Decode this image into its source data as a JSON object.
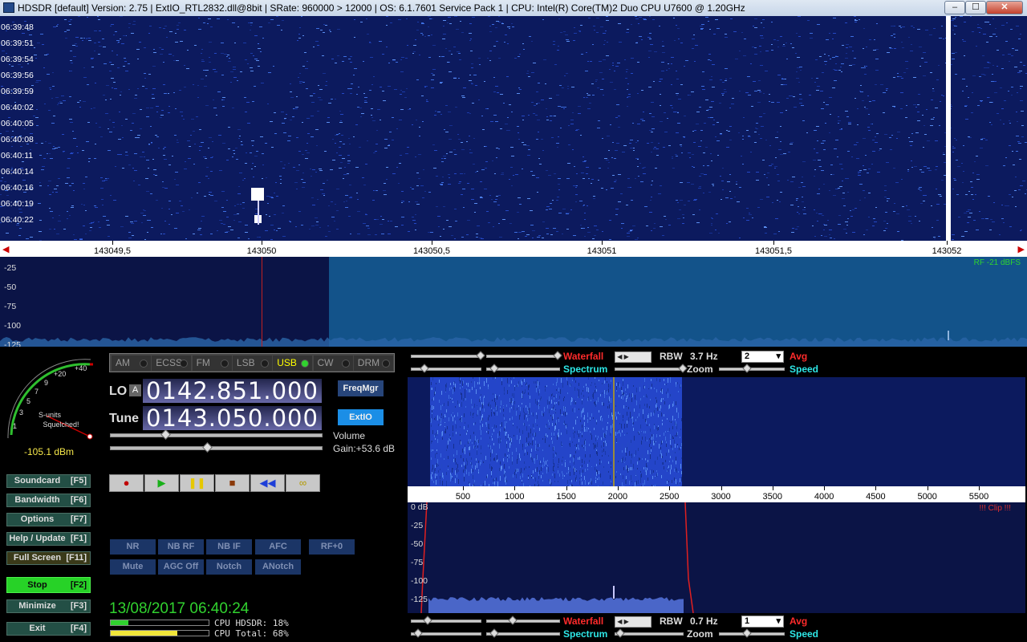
{
  "window": {
    "title": "HDSDR  [default]  Version: 2.75   |  ExtIO_RTL2832.dll@8bit  |  SRate: 960000 > 12000  |  OS: 6.1.7601  Service Pack 1  |  CPU: Intel(R) Core(TM)2 Duo CPU     U7600  @ 1.20GHz",
    "app_icon": "hdsdr-app-icon",
    "controls": {
      "minimize": "–",
      "maximize": "☐",
      "close": "✕"
    }
  },
  "waterfall": {
    "timestamps": [
      "06:39:48",
      "06:39:51",
      "06:39:54",
      "06:39:56",
      "06:39:59",
      "06:40:02",
      "06:40:05",
      "06:40:08",
      "06:40:11",
      "06:40:14",
      "06:40:16",
      "06:40:19",
      "06:40:22"
    ],
    "background_color": "#0c1a5e"
  },
  "frequency_axis": {
    "labels": [
      "143049,5",
      "143050",
      "143050,5",
      "143051",
      "143051,5",
      "143052"
    ]
  },
  "spectrum": {
    "db_labels": [
      "-25",
      "-50",
      "-75",
      "-100",
      "-125"
    ],
    "rf_level": "RF -21 dBFS"
  },
  "smeter": {
    "scale_labels": [
      "1",
      "3",
      "5",
      "7",
      "9",
      "+20",
      "+40"
    ],
    "caption_line1": "S-units",
    "caption_line2": "Squelched!",
    "dbm": "-105.1 dBm"
  },
  "modes": [
    {
      "label": "AM",
      "active": false
    },
    {
      "label": "ECSS",
      "active": false
    },
    {
      "label": "FM",
      "active": false
    },
    {
      "label": "LSB",
      "active": false
    },
    {
      "label": "USB",
      "active": true
    },
    {
      "label": "CW",
      "active": false
    },
    {
      "label": "DRM",
      "active": false
    }
  ],
  "lo": {
    "label": "LO",
    "badge": "A",
    "value": "0142.851.000"
  },
  "tune": {
    "label": "Tune",
    "value": "0143.050.000"
  },
  "buttons": {
    "freqmgr": "FreqMgr",
    "extio": "ExtIO"
  },
  "audio": {
    "volume_label": "Volume",
    "gain_label": "Gain:+53.6 dB"
  },
  "transport": [
    {
      "name": "record",
      "glyph": "●",
      "color": "#c00000"
    },
    {
      "name": "play",
      "glyph": "▶",
      "color": "#19b019"
    },
    {
      "name": "pause",
      "glyph": "❚❚",
      "color": "#e6c800"
    },
    {
      "name": "stop",
      "glyph": "■",
      "color": "#8b3a0a"
    },
    {
      "name": "rewind",
      "glyph": "◀◀",
      "color": "#1e3fd8"
    },
    {
      "name": "loop",
      "glyph": "∞",
      "color": "#b39a00"
    }
  ],
  "dsp_row1": [
    "NR",
    "NB RF",
    "NB IF",
    "AFC",
    "RF+0"
  ],
  "dsp_row2": [
    "Mute",
    "AGC Off",
    "Notch",
    "ANotch"
  ],
  "side_buttons": [
    {
      "label": "Soundcard",
      "key": "[F5]",
      "style": ""
    },
    {
      "label": "Bandwidth",
      "key": "[F6]",
      "style": ""
    },
    {
      "label": "Options",
      "key": "[F7]",
      "style": ""
    },
    {
      "label": "Help / Update",
      "key": "[F1]",
      "style": ""
    },
    {
      "label": "Full Screen",
      "key": "[F11]",
      "style": "full"
    },
    {
      "label": "Stop",
      "key": "[F2]",
      "style": "stop"
    },
    {
      "label": "Minimize",
      "key": "[F3]",
      "style": ""
    },
    {
      "label": "Exit",
      "key": "[F4]",
      "style": ""
    }
  ],
  "datetime": "13/08/2017 06:40:24",
  "cpu": {
    "hdsdr_label": "CPU HDSDR: 18%",
    "total_label": "CPU Total: 68%",
    "hdsdr_pct": 18,
    "total_pct": 68
  },
  "rx_panel_top": {
    "waterfall_label": "Waterfall",
    "spectrum_label": "Spectrum",
    "rbw_label": "RBW",
    "rbw_value": "3.7 Hz",
    "avg_value": "2",
    "avg_label": "Avg",
    "zoom_label": "Zoom",
    "speed_label": "Speed"
  },
  "rx_axis_labels": [
    "500",
    "1000",
    "1500",
    "2000",
    "2500",
    "3000",
    "3500",
    "4000",
    "4500",
    "5000",
    "5500"
  ],
  "rx_spec_db_labels": [
    "0 dB",
    "-25",
    "-50",
    "-75",
    "-100",
    "-125"
  ],
  "clip_label": "!!! Clip !!!",
  "rx_panel_bottom": {
    "waterfall_label": "Waterfall",
    "spectrum_label": "Spectrum",
    "rbw_label": "RBW",
    "rbw_value": "0.7 Hz",
    "avg_value": "1",
    "avg_label": "Avg",
    "zoom_label": "Zoom",
    "speed_label": "Speed"
  }
}
